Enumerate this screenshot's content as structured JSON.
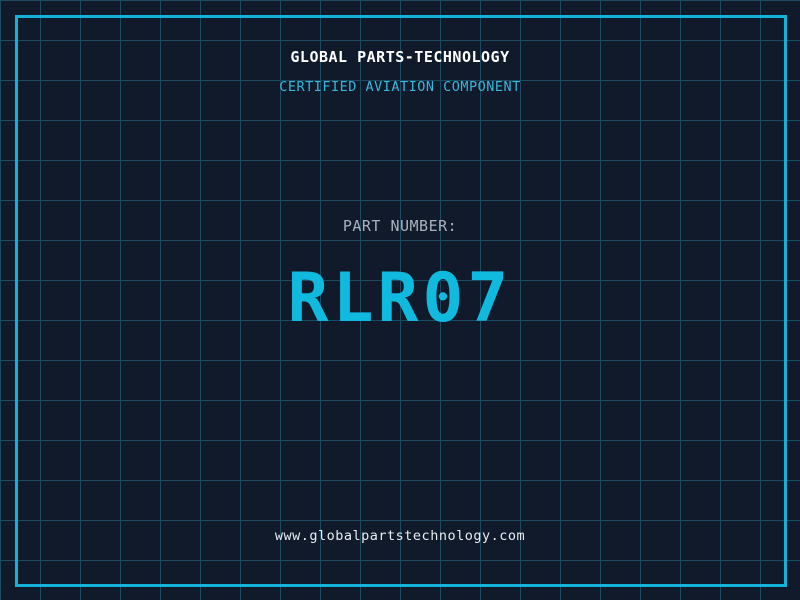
{
  "label": {
    "company_title": "GLOBAL PARTS-TECHNOLOGY",
    "certification_line": "CERTIFIED AVIATION COMPONENT",
    "part_number_label": "PART NUMBER:",
    "part_number": "RLR07",
    "website_url": "www.globalpartstechnology.com"
  },
  "colors": {
    "background": "#101a2b",
    "grid_line": "#1b4b63",
    "frame_border": "#14b1d9",
    "title_text": "#ffffff",
    "certification_text": "#38b6d9",
    "part_label_text": "#a9b2bd",
    "part_number_text": "#10b9de",
    "url_text": "#e8edf2"
  },
  "layout_meta": {
    "grid_cell_px": "40"
  }
}
